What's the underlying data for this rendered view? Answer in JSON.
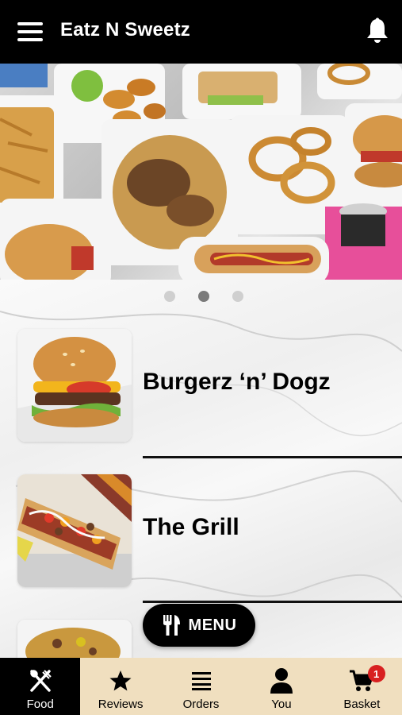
{
  "app": {
    "title": "Eatz N Sweetz"
  },
  "carousel": {
    "slides": 3,
    "active_index": 1
  },
  "categories": [
    {
      "label": "Burgerz ‘n’ Dogz",
      "image": "burger-photo"
    },
    {
      "label": "The Grill",
      "image": "hotdog-photo"
    },
    {
      "label": "",
      "image": "fries-photo"
    }
  ],
  "menu_button": {
    "label": "MENU",
    "icon": "utensils-icon"
  },
  "tabbar": {
    "active": "food",
    "items": [
      {
        "id": "food",
        "label": "Food",
        "icon": "fork-knife-icon"
      },
      {
        "id": "reviews",
        "label": "Reviews",
        "icon": "star-icon"
      },
      {
        "id": "orders",
        "label": "Orders",
        "icon": "list-icon"
      },
      {
        "id": "you",
        "label": "You",
        "icon": "person-icon"
      },
      {
        "id": "basket",
        "label": "Basket",
        "icon": "cart-icon",
        "badge": "1"
      }
    ]
  },
  "colors": {
    "header_bg": "#000000",
    "tabbar_bg": "#f0dfbf",
    "active_tab_bg": "#000000",
    "badge": "#d82020"
  }
}
